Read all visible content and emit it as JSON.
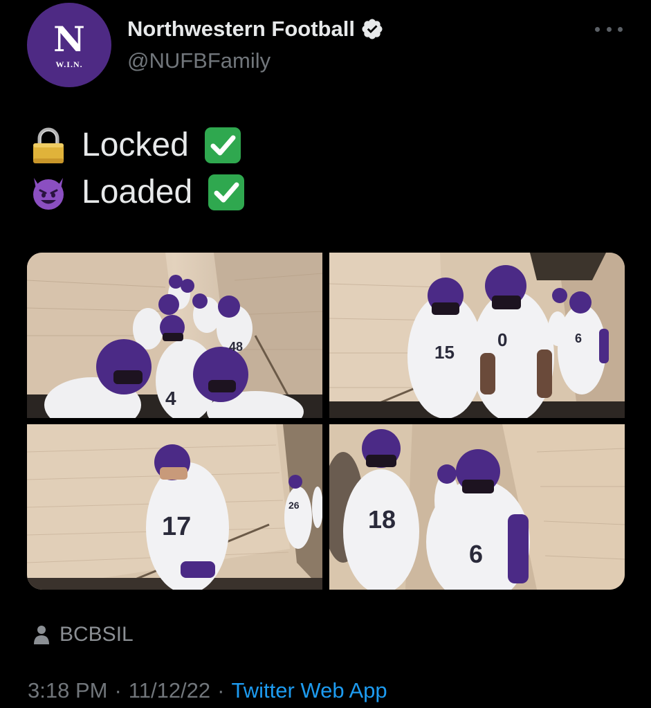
{
  "colors": {
    "background": "#000000",
    "brand": "#4e2a84",
    "link": "#1d9bf0",
    "check_green": "#2fa84f"
  },
  "author": {
    "avatar_letter": "N",
    "avatar_sub": "W.I.N.",
    "display_name": "Northwestern Football",
    "handle": "@NUFBFamily",
    "verified_icon": "verified-badge-icon"
  },
  "tweet": {
    "lines": [
      {
        "emoji_icon": "lock-icon",
        "text": "Locked",
        "check_icon": "green-check-icon"
      },
      {
        "emoji_icon": "smiling-devil-icon",
        "text": "Loaded",
        "check_icon": "green-check-icon"
      }
    ]
  },
  "media": {
    "photos": [
      {
        "description_icon": "players-tunnel-photo"
      },
      {
        "description_icon": "players-tunnel-photo"
      },
      {
        "description_icon": "players-tunnel-photo"
      },
      {
        "description_icon": "players-tunnel-photo"
      }
    ]
  },
  "tagged": {
    "icon": "person-icon",
    "label": "BCBSIL"
  },
  "meta": {
    "time": "3:18 PM",
    "separator1": "·",
    "date": "11/12/22",
    "separator2": "·",
    "source": "Twitter Web App"
  }
}
